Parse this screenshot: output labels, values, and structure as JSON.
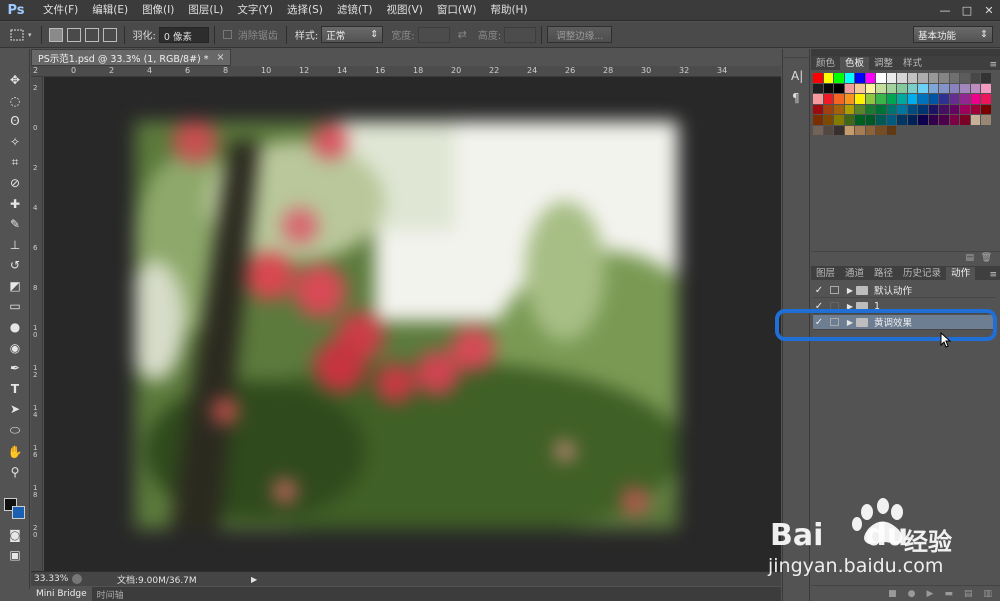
{
  "app": {
    "logo": "Ps"
  },
  "menu": [
    "文件(F)",
    "编辑(E)",
    "图像(I)",
    "图层(L)",
    "文字(Y)",
    "选择(S)",
    "滤镜(T)",
    "视图(V)",
    "窗口(W)",
    "帮助(H)"
  ],
  "window_controls": {
    "minimize": "—",
    "maximize": "□",
    "close": "✕"
  },
  "options": {
    "feather_label": "羽化:",
    "feather_value": "0 像素",
    "antialias_label": "消除锯齿",
    "style_label": "样式:",
    "style_value": "正常",
    "width_label": "宽度:",
    "height_label": "高度:",
    "refine_edge_label": "调整边缘...",
    "workspace_value": "基本功能"
  },
  "document": {
    "tab_title": "PS示范1.psd @ 33.3% (1, RGB/8#) *",
    "zoom": "33.33%",
    "doc_info": "文档:9.00M/36.7M"
  },
  "ruler_h_labels": [
    "2",
    "0",
    "2",
    "4",
    "6",
    "8",
    "10",
    "12",
    "14",
    "16",
    "18",
    "20",
    "22",
    "24",
    "26",
    "28",
    "30",
    "32",
    "34"
  ],
  "ruler_v_labels": [
    "2",
    "0",
    "2",
    "4",
    "6",
    "8",
    "1 0",
    "1 2",
    "1 4",
    "1 6",
    "1 8",
    "2 0"
  ],
  "bottom_tabs": [
    "Mini Bridge",
    "时间轴"
  ],
  "swatch_panel": {
    "tabs": [
      "颜色",
      "色板",
      "调整",
      "样式"
    ],
    "active_tab": "色板"
  },
  "actions_panel": {
    "tabs": [
      "图层",
      "通道",
      "路径",
      "历史记录",
      "动作"
    ],
    "active_tab": "动作",
    "rows": [
      {
        "label": "默认动作",
        "selected": false
      },
      {
        "label": "1",
        "selected": false
      },
      {
        "label": "黄调效果",
        "selected": true
      }
    ]
  },
  "watermark": {
    "brand": "Bai",
    "brand_tail": "du",
    "cn": "经验",
    "url": "jingyan.baidu.com"
  },
  "colors": {
    "highlight": "#1f6fd6",
    "selected_row": "#6d7d92",
    "watermark_blue": "#2b6fc7",
    "watermark_red": "#d42c2c"
  },
  "swatches": [
    "#ff0000",
    "#ffff00",
    "#00ff00",
    "#00ffff",
    "#0000ff",
    "#ff00ff",
    "#ffffff",
    "#ebebeb",
    "#d6d6d6",
    "#c2c2c2",
    "#adadad",
    "#999999",
    "#858585",
    "#707070",
    "#5c5c5c",
    "#474747",
    "#333333",
    "#1f1f1f",
    "#0a0a0a",
    "#000000",
    "#f29b9b",
    "#f7c89a",
    "#fdf49c",
    "#c4df9b",
    "#a3d39c",
    "#82ca9c",
    "#7bcdc8",
    "#6ecff6",
    "#7ea7d8",
    "#8493ca",
    "#8882be",
    "#a187be",
    "#bc8dbf",
    "#f49ac2",
    "#f6989d",
    "#ed1c24",
    "#f26522",
    "#f7941d",
    "#fff200",
    "#8dc73f",
    "#39b54a",
    "#00a651",
    "#00a99d",
    "#00aeef",
    "#0072bc",
    "#0054a6",
    "#2e3192",
    "#662d91",
    "#92278f",
    "#ec008c",
    "#ed145b",
    "#9e0b0f",
    "#a0410d",
    "#a36209",
    "#aba000",
    "#598527",
    "#1a7b30",
    "#007236",
    "#00746b",
    "#0076a3",
    "#004b80",
    "#003471",
    "#1b1464",
    "#440e62",
    "#630460",
    "#9e005d",
    "#9e0039",
    "#790000",
    "#7b2e00",
    "#7d4900",
    "#827b00",
    "#406618",
    "#005e20",
    "#005826",
    "#005952",
    "#005b7f",
    "#003663",
    "#002157",
    "#0d004c",
    "#32004b",
    "#4b0049",
    "#7b0046",
    "#7a0026",
    "#c7b299",
    "#998675",
    "#736357",
    "#534741",
    "#37302d",
    "#c69c6d",
    "#a67c52",
    "#8c6239",
    "#754c24",
    "#603913"
  ]
}
